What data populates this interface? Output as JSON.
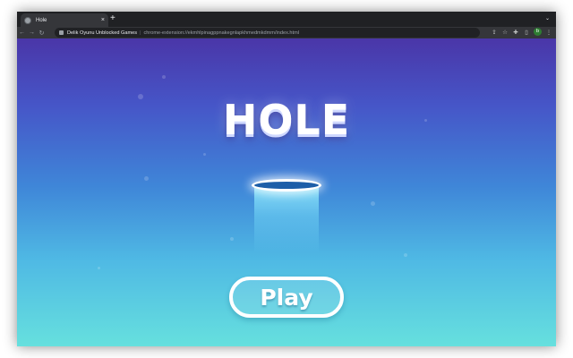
{
  "browser": {
    "tab": {
      "title": "Hole",
      "favicon": "game-favicon-icon",
      "close_glyph": "×"
    },
    "new_tab_glyph": "+",
    "tab_search_glyph": "⌄",
    "nav": {
      "back_glyph": "←",
      "forward_glyph": "→",
      "reload_glyph": "↻"
    },
    "omnibox": {
      "site_name": "Delik Oyunu Unblocked Games",
      "separator": "|",
      "url": "chrome-extension://ekmhlpinagppnakegnlapkhmedmkdmm/index.html"
    },
    "toolbar_icons": [
      "share-icon",
      "bookmark-star-icon",
      "extensions-puzzle-icon",
      "side-panel-icon"
    ],
    "toolbar_glyphs": {
      "share": "⇪",
      "bookmark": "☆",
      "extensions": "✚",
      "side_panel": "▯",
      "menu": "⋮"
    },
    "profile_initial": "b"
  },
  "game": {
    "title": "HOLE",
    "play_label": "Play",
    "colors": {
      "gradient_top": "#4a36a8",
      "gradient_bottom": "#66e0de",
      "hole_fill": "#1d5ea8",
      "text": "#ffffff"
    }
  }
}
